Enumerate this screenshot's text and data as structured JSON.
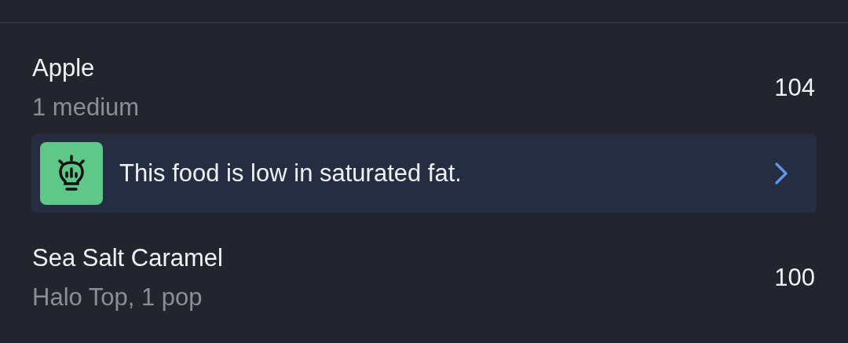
{
  "foods": [
    {
      "name": "Apple",
      "detail": "1 medium",
      "calories": "104",
      "tip": {
        "text": "This food is low in saturated fat."
      }
    },
    {
      "name": "Sea Salt Caramel",
      "detail": "Halo Top, 1 pop",
      "calories": "100"
    }
  ]
}
